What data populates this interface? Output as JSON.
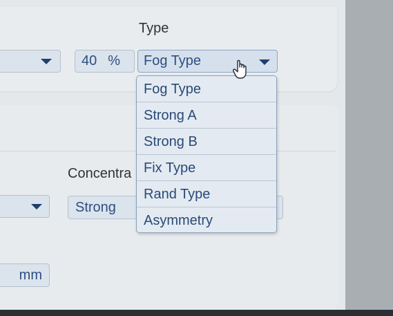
{
  "type_section": {
    "heading": "Type",
    "percent_value": "40",
    "percent_unit": "%",
    "selected_type": "Fog Type",
    "options": [
      "Fog Type",
      "Strong A",
      "Strong B",
      "Fix Type",
      "Rand Type",
      "Asymmetry"
    ]
  },
  "concentration_section": {
    "label": "Concentra",
    "selected_value": "Strong"
  },
  "distance_field": {
    "unit": "mm"
  },
  "icons": {
    "dropdown": "chevron-down-icon",
    "cursor": "hand-pointer-icon"
  }
}
